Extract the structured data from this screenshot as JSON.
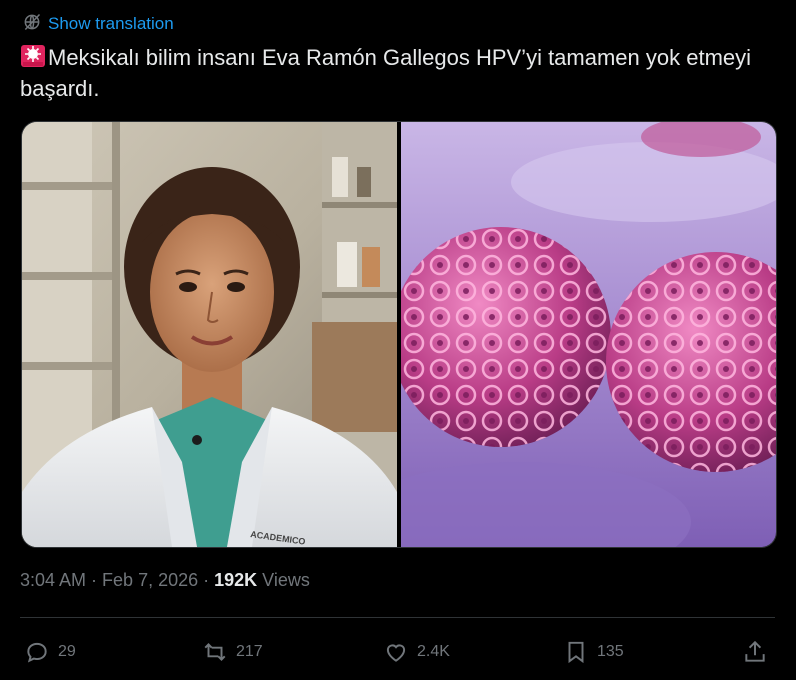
{
  "translate": {
    "label": "Show translation",
    "icon": "globe-slash-icon"
  },
  "tweet": {
    "emoji": "police-light-emoji",
    "text": "Meksikalı bilim insanı Eva Ramón Gallegos HPV’yi tamamen yok etmeyi başardı."
  },
  "media": {
    "left_image": "scientist-portrait",
    "left_coat_text": "ACADEMICO",
    "right_image": "hpv-virus-illustration"
  },
  "meta": {
    "time": "3:04 AM",
    "separator": "·",
    "date": "Feb 7, 2026",
    "views_count": "192K",
    "views_label": "Views"
  },
  "actions": {
    "replies": "29",
    "reposts": "217",
    "likes": "2.4K",
    "bookmarks": "135"
  },
  "colors": {
    "background": "#000000",
    "text": "#e7e9ea",
    "muted": "#71767b",
    "link": "#1d9bf0",
    "divider": "#2f3336"
  }
}
